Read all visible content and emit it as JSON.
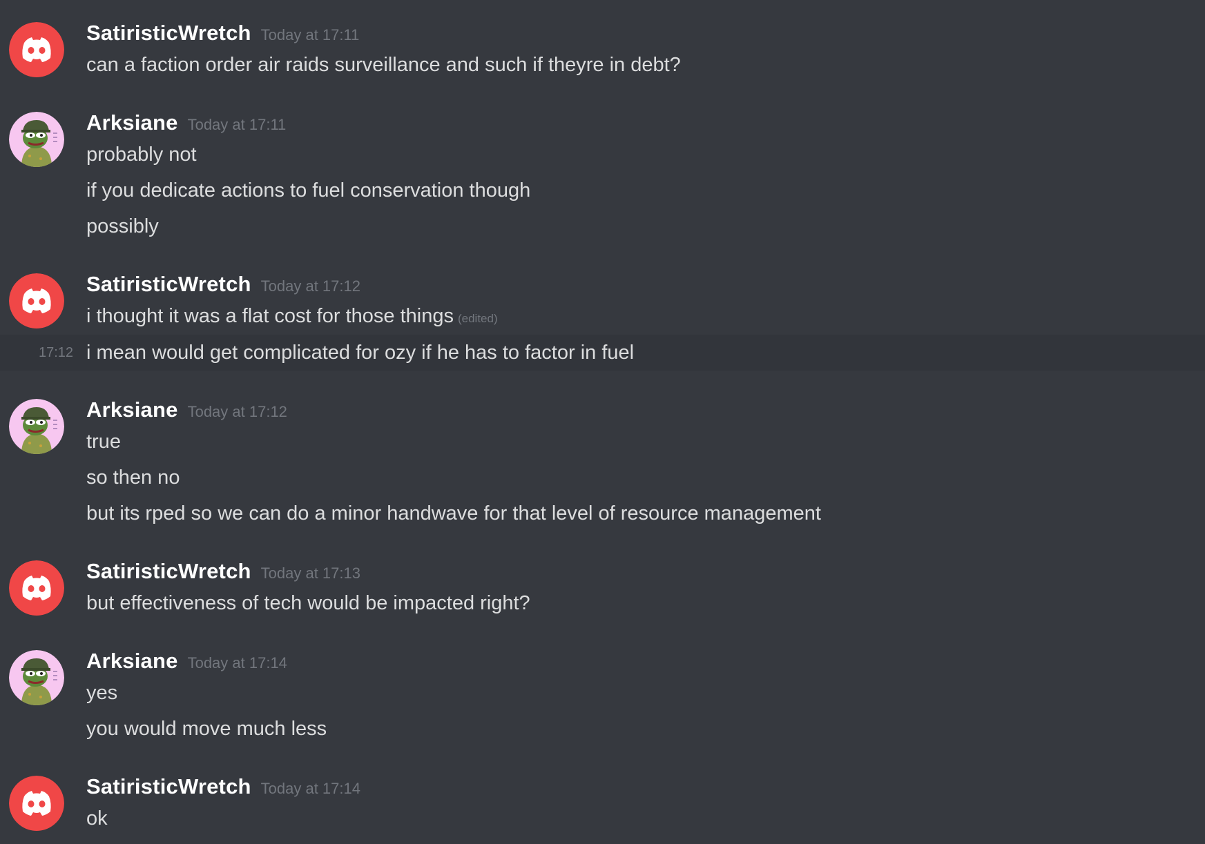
{
  "colors": {
    "background": "#36393f",
    "hover_row": "#32353b",
    "username": "#ffffff",
    "timestamp": "#72767d",
    "message_text": "#dcddde",
    "discord_avatar": "#f04747",
    "pepe_avatar_bg": "#f7c7f0"
  },
  "messages": [
    {
      "author": "SatiristicWretch",
      "avatar_icon": "discord-logo-icon",
      "timestamp": "Today at 17:11",
      "lines": [
        "can a faction order air raids surveillance and such if theyre in debt?"
      ]
    },
    {
      "author": "Arksiane",
      "avatar_icon": "pepe-soldier-avatar",
      "timestamp": "Today at 17:11",
      "lines": [
        "probably not",
        "if you dedicate actions to fuel conservation though",
        "possibly"
      ]
    },
    {
      "author": "SatiristicWretch",
      "avatar_icon": "discord-logo-icon",
      "timestamp": "Today at 17:12",
      "lines": [
        "i thought it was a flat cost for those things",
        "i mean would get complicated for ozy if he has to factor in fuel"
      ],
      "edited_label": "(edited)",
      "hover_time": "17:12"
    },
    {
      "author": "Arksiane",
      "avatar_icon": "pepe-soldier-avatar",
      "timestamp": "Today at 17:12",
      "lines": [
        "true",
        "so then no",
        "but its rped so we can do a minor handwave for that level of resource management"
      ]
    },
    {
      "author": "SatiristicWretch",
      "avatar_icon": "discord-logo-icon",
      "timestamp": "Today at 17:13",
      "lines": [
        "but effectiveness of tech would be impacted right?"
      ]
    },
    {
      "author": "Arksiane",
      "avatar_icon": "pepe-soldier-avatar",
      "timestamp": "Today at 17:14",
      "lines": [
        "yes",
        "you would move much less"
      ]
    },
    {
      "author": "SatiristicWretch",
      "avatar_icon": "discord-logo-icon",
      "timestamp": "Today at 17:14",
      "lines": [
        "ok"
      ]
    }
  ]
}
